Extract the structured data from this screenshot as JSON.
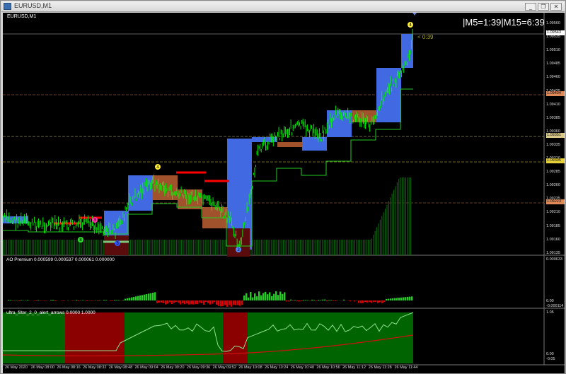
{
  "window": {
    "title": "EURUSD,M1",
    "minimize": "_",
    "restore": "❐",
    "close": "✕"
  },
  "chart": {
    "symbol_label": "EURUSD,M1",
    "timer_text": "|M5=1:39|M15=6:39",
    "countdown_text": "< 0:39",
    "price_axis": [
      "1.09560",
      "1.09535",
      "1.09510",
      "1.09485",
      "1.09460",
      "1.09435",
      "1.09410",
      "1.09385",
      "1.09360",
      "1.09335",
      "1.09310",
      "1.09285",
      "1.09260",
      "1.09235",
      "1.09210",
      "1.09185",
      "1.09160",
      "1.09135"
    ],
    "price_tags": [
      {
        "text": "1.09543",
        "color": "#ffffff"
      },
      {
        "text": "1.09434",
        "color": "#e08a5a"
      },
      {
        "text": "1.09351",
        "color": "#d9c98a"
      },
      {
        "text": "1.09305",
        "color": "#e8d23a"
      },
      {
        "text": "1.09223",
        "color": "#e08a5a"
      }
    ],
    "time_axis": [
      "26 May 2020",
      "26 May 08:00",
      "26 May 08:16",
      "26 May 08:32",
      "26 May 08:48",
      "26 May 09:04",
      "26 May 09:20",
      "26 May 09:36",
      "26 May 09:52",
      "26 May 10:08",
      "26 May 10:24",
      "26 May 10:40",
      "26 May 10:56",
      "26 May 11:12",
      "26 May 11:28",
      "26 May 11:44"
    ],
    "markers": [
      "3",
      "4",
      "3",
      "8",
      "4"
    ]
  },
  "ao_panel": {
    "label": "AO Premium 0.000599 0.000537 0.000061 0.000000",
    "axis": [
      "0.000633",
      "0.00",
      "-0.000114"
    ]
  },
  "ultra_panel": {
    "label": "ultra_filter_2_0_alert_arrows 0.0000 1.0000",
    "axis": [
      "1.05",
      "0.00",
      "-0.05"
    ]
  },
  "colors": {
    "background": "#000000",
    "bull_box": "#4169e1",
    "bear_box": "#a0522d",
    "candle": "#00ff00",
    "support_line": "#22cc22",
    "resistance_line": "#ff0000",
    "ao_up": "#22cc22",
    "ao_down": "#dd0000",
    "ultra_bull": "#006400",
    "ultra_bear": "#8b0000"
  }
}
